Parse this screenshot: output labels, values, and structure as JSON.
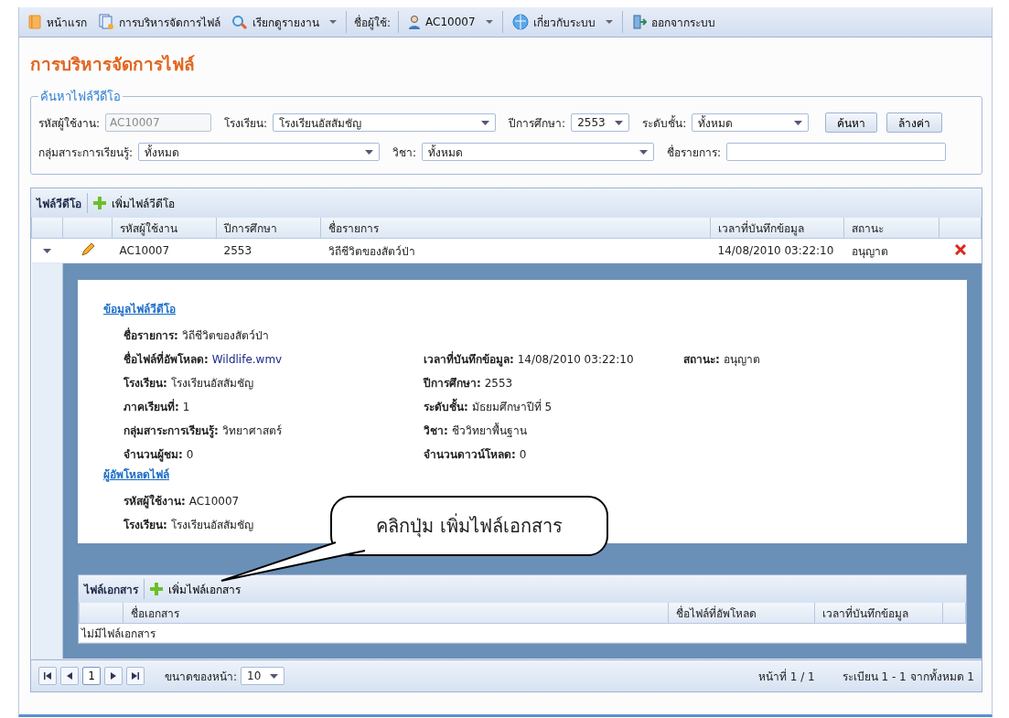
{
  "menu": [
    {
      "kind": "item",
      "label": "หน้าแรก"
    },
    {
      "kind": "item",
      "label": "การบริหารจัดการไฟล์"
    },
    {
      "kind": "dropdown",
      "label": "เรียกดูรายงาน"
    },
    {
      "kind": "text",
      "label": "ชื่อผู้ใช้:"
    },
    {
      "kind": "dropdown",
      "label": "AC10007"
    },
    {
      "kind": "dropdown",
      "label": "เกี่ยวกับระบบ"
    },
    {
      "kind": "item",
      "label": "ออกจากระบบ"
    }
  ],
  "page_title": "การบริหารจัดการไฟล์",
  "search": {
    "legend": "ค้นหาไฟล์วีดีโอ",
    "fields": [
      {
        "label": "รหัสผู้ใช้งาน:",
        "kind": "text",
        "value": "AC10007",
        "disabled": true
      },
      {
        "label": "โรงเรียน:",
        "kind": "combo",
        "value": "โรงเรียนอัสสัมชัญ"
      },
      {
        "label": "ปีการศึกษา:",
        "kind": "combo",
        "value": "2553"
      },
      {
        "label": "ระดับชั้น:",
        "kind": "combo",
        "value": "ทั้งหมด"
      },
      {
        "label": "กลุ่มสาระการเรียนรู้:",
        "kind": "combo",
        "value": "ทั้งหมด"
      },
      {
        "label": "วิชา:",
        "kind": "combo",
        "value": "ทั้งหมด"
      },
      {
        "label": "ชื่อรายการ:",
        "kind": "text",
        "disabled": false
      }
    ],
    "buttons": [
      "ค้นหา",
      "ล้างค่า"
    ]
  },
  "grid": {
    "title": "ไฟล์วีดีโอ",
    "add_label": "เพิ่มไฟล์วีดีโอ",
    "columns": [
      "รหัสผู้ใช้งาน",
      "ปีการศึกษา",
      "ชื่อรายการ",
      "เวลาที่บันทึกข้อมูล",
      "สถานะ"
    ],
    "rows": [
      {
        "cells": [
          "AC10007",
          "2553",
          "วิถีชีวิตของสัตว์ป่า",
          "14/08/2010 03:22:10",
          "อนุญาต"
        ],
        "expanded": true
      }
    ]
  },
  "detail": {
    "sections": [
      {
        "title": "ข้อมูลไฟล์วีดีโอ",
        "fields": [
          {
            "label": "ชื่อรายการ:",
            "value": "วิถีชีวิตของสัตว์ป่า",
            "link": false
          },
          {
            "label": "ชื่อไฟล์ที่อัพโหลด:",
            "value": "Wildlife.wmv",
            "link": true
          },
          {
            "label": "เวลาที่บันทึกข้อมูล:",
            "value": "14/08/2010 03:22:10",
            "link": false
          },
          {
            "label": "สถานะ:",
            "value": "อนุญาต",
            "link": false
          },
          {
            "label": "โรงเรียน:",
            "value": "โรงเรียนอัสสัมชัญ",
            "link": false
          },
          {
            "label": "ปีการศึกษา:",
            "value": "2553",
            "link": false
          },
          {
            "label": "ภาคเรียนที่:",
            "value": "1",
            "link": false
          },
          {
            "label": "ระดับชั้น:",
            "value": "มัธยมศึกษาปีที่ 5",
            "link": false
          },
          {
            "label": "กลุ่มสาระการเรียนรู้:",
            "value": "วิทยาศาสตร์",
            "link": false
          },
          {
            "label": "วิชา:",
            "value": "ชีววิทยาพื้นฐาน",
            "link": false
          },
          {
            "label": "จำนวนผู้ชม:",
            "value": "0",
            "link": false
          },
          {
            "label": "จำนวนดาวน์โหลด:",
            "value": "0",
            "link": false
          }
        ]
      },
      {
        "title": "ผู้อัพโหลดไฟล์",
        "fields": [
          {
            "label": "รหัสผู้ใช้งาน:",
            "value": "AC10007",
            "link": false
          },
          {
            "label": "โรงเรียน:",
            "value": "โรงเรียนอัสสัมชัญ",
            "link": false
          }
        ]
      }
    ],
    "callout": "คลิกปุ่ม เพิ่มไฟล์เอกสาร",
    "docs": {
      "title": "ไฟล์เอกสาร",
      "add_label": "เพิ่มไฟล์เอกสาร",
      "columns": [
        "ชื่อเอกสาร",
        "ชื่อไฟล์ที่อัพโหลด",
        "เวลาที่บันทึกข้อมูล"
      ],
      "empty": "ไม่มีไฟล์เอกสาร"
    }
  },
  "pager": {
    "current": "1",
    "page_size_label": "ขนาดของหน้า:",
    "page_size": "10",
    "page_info": "หน้าที่ 1 / 1",
    "record_info": "ระเบียน 1 - 1 จากทั้งหมด 1"
  }
}
